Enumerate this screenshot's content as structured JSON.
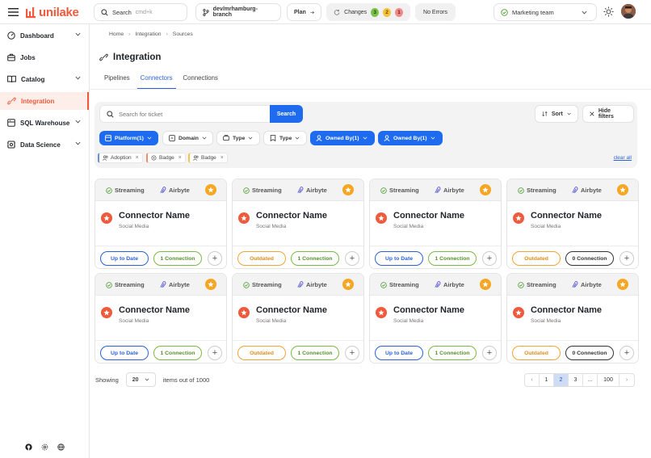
{
  "app": {
    "name": "unilake"
  },
  "topbar": {
    "search_label": "Search",
    "search_shortcut": "cmd+k",
    "branch": "dev/mrhamburg-branch",
    "plan_label": "Plan",
    "changes_label": "Changes",
    "changes_counts": [
      "3",
      "2",
      "1"
    ],
    "errors_label": "No Errors",
    "team": "Marketing team"
  },
  "sidebar": {
    "items": [
      {
        "label": "Dashboard",
        "icon": "dashboard-icon",
        "expandable": true
      },
      {
        "label": "Jobs",
        "icon": "jobs-icon",
        "expandable": false
      },
      {
        "label": "Catalog",
        "icon": "catalog-icon",
        "expandable": true
      },
      {
        "label": "Integration",
        "icon": "integration-icon",
        "expandable": false,
        "active": true
      },
      {
        "label": "SQL Warehouse",
        "icon": "sql-warehouse-icon",
        "expandable": true
      },
      {
        "label": "Data Science",
        "icon": "data-science-icon",
        "expandable": true
      }
    ]
  },
  "breadcrumb": [
    "Home",
    "Integration",
    "Sources"
  ],
  "page": {
    "title": "Integration"
  },
  "subtabs": [
    {
      "label": "Pipelines",
      "active": false
    },
    {
      "label": "Connectors",
      "active": true
    },
    {
      "label": "Connections",
      "active": false
    }
  ],
  "filters": {
    "search_placeholder": "Search for ticket",
    "search_button": "Search",
    "sort_label": "Sort",
    "hide_filters_label": "Hide filters",
    "chips": [
      {
        "label": "Platform(1)",
        "active": true
      },
      {
        "label": "Domain",
        "active": false
      },
      {
        "label": "Type",
        "active": false
      },
      {
        "label": "Type",
        "active": false
      },
      {
        "label": "Owned By(1)",
        "active": true
      },
      {
        "label": "Owned By(1)",
        "active": true
      }
    ],
    "tags": [
      "Adoption",
      "Badge",
      "Badge"
    ],
    "clear_all": "clear all"
  },
  "colors": {
    "accent": "#1f6bf0",
    "brand": "#ef5a3c",
    "up_to_date": "#2b62d9",
    "outdated": "#e08d1c",
    "connection": "#57902a"
  },
  "cards": [
    {
      "type": "Streaming",
      "source": "Airbyte",
      "name": "Connector Name",
      "category": "Social Media",
      "status": "Up to Date",
      "status_kind": "uptodate",
      "connection": "1 Connection",
      "connection_kind": "green"
    },
    {
      "type": "Streaming",
      "source": "Airbyte",
      "name": "Connector Name",
      "category": "Social Media",
      "status": "Outdated",
      "status_kind": "outdated",
      "connection": "1 Connection",
      "connection_kind": "green"
    },
    {
      "type": "Streaming",
      "source": "Airbyte",
      "name": "Connector Name",
      "category": "Social Media",
      "status": "Up to Date",
      "status_kind": "uptodate",
      "connection": "1 Connection",
      "connection_kind": "green"
    },
    {
      "type": "Streaming",
      "source": "Airbyte",
      "name": "Connector Name",
      "category": "Social Media",
      "status": "Outdated",
      "status_kind": "outdated",
      "connection": "0 Connection",
      "connection_kind": "gray"
    },
    {
      "type": "Streaming",
      "source": "Airbyte",
      "name": "Connector Name",
      "category": "Social Media",
      "status": "Up to Date",
      "status_kind": "uptodate",
      "connection": "1 Connection",
      "connection_kind": "green"
    },
    {
      "type": "Streaming",
      "source": "Airbyte",
      "name": "Connector Name",
      "category": "Social Media",
      "status": "Outdated",
      "status_kind": "outdated",
      "connection": "1 Connection",
      "connection_kind": "green"
    },
    {
      "type": "Streaming",
      "source": "Airbyte",
      "name": "Connector Name",
      "category": "Social Media",
      "status": "Up to Date",
      "status_kind": "uptodate",
      "connection": "1 Connection",
      "connection_kind": "green"
    },
    {
      "type": "Streaming",
      "source": "Airbyte",
      "name": "Connector Name",
      "category": "Social Media",
      "status": "Outdated",
      "status_kind": "outdated",
      "connection": "0 Connection",
      "connection_kind": "gray"
    }
  ],
  "pagination": {
    "showing_label": "Showing",
    "page_size": "20",
    "items_label": "items out of 1000",
    "pages": [
      "1",
      "2",
      "3",
      "...",
      "100"
    ],
    "current_page": "2"
  }
}
